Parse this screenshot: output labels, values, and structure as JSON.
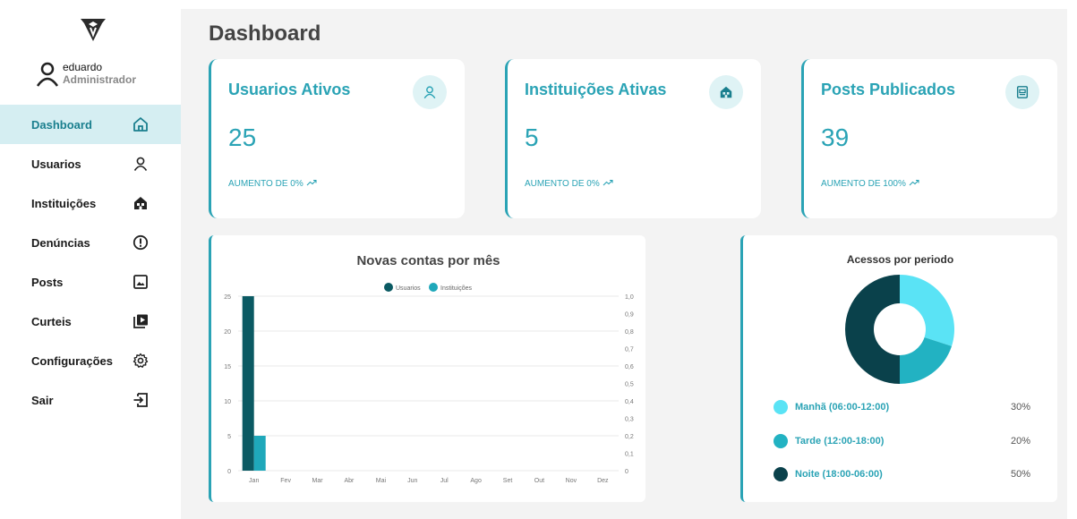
{
  "sidebar": {
    "user": {
      "name": "eduardo",
      "role": "Administrador"
    },
    "items": [
      {
        "label": "Dashboard",
        "icon": "home-icon",
        "active": true
      },
      {
        "label": "Usuarios",
        "icon": "user-icon",
        "active": false
      },
      {
        "label": "Instituições",
        "icon": "institution-icon",
        "active": false
      },
      {
        "label": "Denúncias",
        "icon": "alert-icon",
        "active": false
      },
      {
        "label": "Posts",
        "icon": "image-icon",
        "active": false
      },
      {
        "label": "Curteis",
        "icon": "video-library-icon",
        "active": false
      },
      {
        "label": "Configurações",
        "icon": "gear-icon",
        "active": false
      },
      {
        "label": "Sair",
        "icon": "logout-icon",
        "active": false
      }
    ]
  },
  "header": {
    "title": "Dashboard"
  },
  "cards": [
    {
      "title": "Usuarios Ativos",
      "value": "25",
      "footer": "AUMENTO DE 0%",
      "icon": "user-icon"
    },
    {
      "title": "Instituições Ativas",
      "value": "5",
      "footer": "AUMENTO DE 0%",
      "icon": "institution-icon"
    },
    {
      "title": "Posts Publicados",
      "value": "39",
      "footer": "AUMENTO DE 100%",
      "icon": "post-icon"
    }
  ],
  "colors": {
    "accent": "#2aa3b5",
    "active_bg": "#d5eef2",
    "dark": "#0b4f5a",
    "light": "#5ae3f5"
  },
  "chart_data": [
    {
      "type": "bar",
      "title": "Novas contas por mês",
      "categories": [
        "Jan",
        "Fev",
        "Mar",
        "Abr",
        "Mai",
        "Jun",
        "Jul",
        "Ago",
        "Set",
        "Out",
        "Nov",
        "Dez"
      ],
      "series": [
        {
          "name": "Usuarios",
          "values": [
            25,
            0,
            0,
            0,
            0,
            0,
            0,
            0,
            0,
            0,
            0,
            0
          ],
          "color": "#0b5a63"
        },
        {
          "name": "Instituições",
          "values": [
            5,
            0,
            0,
            0,
            0,
            0,
            0,
            0,
            0,
            0,
            0,
            0
          ],
          "color": "#1fa8ba"
        }
      ],
      "ylim": [
        0,
        25
      ],
      "yticks": [
        "0",
        "5",
        "10",
        "15",
        "20",
        "25"
      ],
      "y2ticks": [
        "0",
        "0,1",
        "0,2",
        "0,3",
        "0,4",
        "0,5",
        "0,6",
        "0,7",
        "0,8",
        "0,9",
        "1,0"
      ],
      "legend": "top-center",
      "grid": true
    },
    {
      "type": "pie",
      "title": "Acessos por periodo",
      "slices": [
        {
          "label": "Manhã (06:00-12:00)",
          "value": 30,
          "pct": "30%",
          "color": "#5ae3f5"
        },
        {
          "label": "Tarde (12:00-18:00)",
          "value": 20,
          "pct": "20%",
          "color": "#22b2c2"
        },
        {
          "label": "Noite (18:00-06:00)",
          "value": 50,
          "pct": "50%",
          "color": "#0a414b"
        }
      ]
    }
  ]
}
